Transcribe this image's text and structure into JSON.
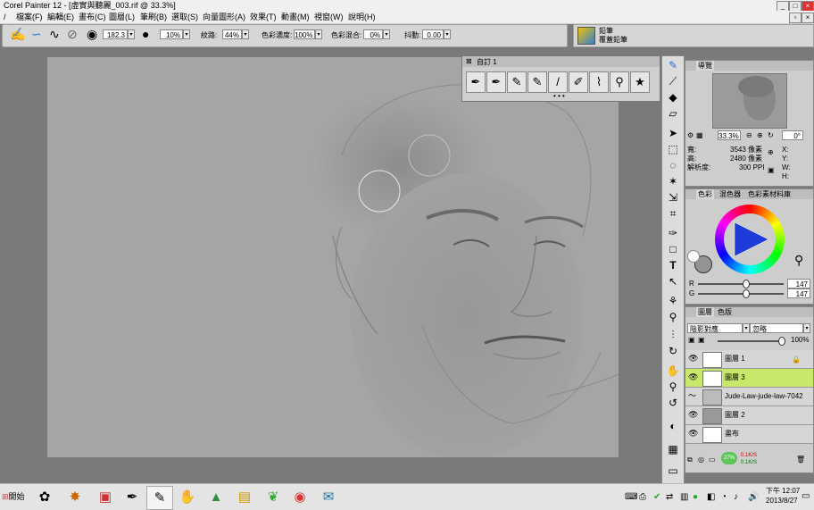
{
  "window": {
    "title": "Corel Painter 12 - [虛實與聽麗_003.rif @ 33.3%]"
  },
  "menu": [
    "檔案(F)",
    "編輯(E)",
    "畫布(C)",
    "圖層(L)",
    "筆刷(B)",
    "選取(S)",
    "向量圖形(A)",
    "效果(T)",
    "動畫(M)",
    "視窗(W)",
    "說明(H)"
  ],
  "property_bar": {
    "size_value": "182.3",
    "opacity_value": "10%",
    "grain_label": "紋路:",
    "grain_value": "44%",
    "resat_label": "色彩濃度:",
    "resat_value": "100%",
    "bleed_label": "色彩混合:",
    "bleed_value": "0%",
    "jitter_label": "抖動:",
    "jitter_value": "0.00"
  },
  "brush_selector": {
    "category": "鉛筆",
    "variant": "覆蓋鉛筆"
  },
  "custom_palette": {
    "title": "自訂 1"
  },
  "navigator": {
    "tab": "導覽",
    "zoom": "33.3%",
    "rotation": "0°",
    "width_label": "寬:",
    "width_value": "3543 像素",
    "height_label": "高:",
    "height_value": "2480 像素",
    "res_label": "解析度:",
    "res_value": "300 PPI",
    "x_label": "X:",
    "y_label": "Y:",
    "w_label": "W:",
    "h_label": "H:"
  },
  "color_panel": {
    "tabs": [
      "色彩",
      "混色器",
      "色彩素材料庫"
    ],
    "r_label": "R",
    "r_value": "147",
    "g_label": "G",
    "g_value": "147"
  },
  "layers_panel": {
    "tabs": [
      "圖層",
      "色版"
    ],
    "composite_method": "陰影對應",
    "composite_depth": "忽略",
    "opacity": "100%",
    "layers": [
      {
        "name": "圖層 1",
        "selected": false
      },
      {
        "name": "圖層 3",
        "selected": true
      },
      {
        "name": "Jude-Law-jude-law-7042",
        "selected": false
      },
      {
        "name": "圖層 2",
        "selected": false
      },
      {
        "name": "畫布",
        "selected": false
      }
    ],
    "net_up": "0.1K/S",
    "net_down": "0.1K/S",
    "net_pct": "27%"
  },
  "taskbar": {
    "start": "開始",
    "time": "下午 12:07",
    "date": "2013/8/27"
  },
  "colors": {
    "selected_layer": "#c7e86a",
    "canvas": "#a5a5a5",
    "workspace": "#7a7a7a"
  }
}
